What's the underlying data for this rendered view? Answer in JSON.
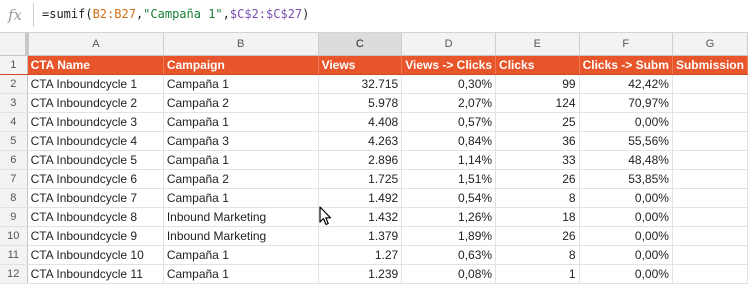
{
  "formula_bar": {
    "fx_label": "fx",
    "parts": [
      "=sumif(",
      "B2:B27",
      ",",
      "\"Campaña 1\"",
      ",",
      "$C$2:$C$27",
      ")"
    ]
  },
  "columns": [
    "A",
    "B",
    "C",
    "D",
    "E",
    "F",
    "G"
  ],
  "header": {
    "row_number": "1",
    "cells": [
      "CTA Name",
      "Campaign",
      "Views",
      "Views -> Clicks",
      "Clicks",
      "Clicks -> Subm",
      "Submission"
    ]
  },
  "rows": [
    {
      "n": "2",
      "cells": [
        "CTA Inboundcycle 1",
        "Campaña 1",
        "32.715",
        "0,30%",
        "99",
        "42,42%",
        ""
      ]
    },
    {
      "n": "3",
      "cells": [
        "CTA Inboundcycle 2",
        "Campaña 2",
        "5.978",
        "2,07%",
        "124",
        "70,97%",
        ""
      ]
    },
    {
      "n": "4",
      "cells": [
        "CTA Inboundcycle 3",
        "Campaña 1",
        "4.408",
        "0,57%",
        "25",
        "0,00%",
        ""
      ]
    },
    {
      "n": "5",
      "cells": [
        "CTA Inboundcycle 4",
        "Campaña 3",
        "4.263",
        "0,84%",
        "36",
        "55,56%",
        ""
      ]
    },
    {
      "n": "6",
      "cells": [
        "CTA Inboundcycle 5",
        "Campaña 1",
        "2.896",
        "1,14%",
        "33",
        "48,48%",
        ""
      ]
    },
    {
      "n": "7",
      "cells": [
        "CTA Inboundcycle 6",
        "Campaña 2",
        "1.725",
        "1,51%",
        "26",
        "53,85%",
        ""
      ]
    },
    {
      "n": "8",
      "cells": [
        "CTA Inboundcycle 7",
        "Campaña 1",
        "1.492",
        "0,54%",
        "8",
        "0,00%",
        ""
      ]
    },
    {
      "n": "9",
      "cells": [
        "CTA Inboundcycle 8",
        "Inbound Marketing",
        "1.432",
        "1,26%",
        "18",
        "0,00%",
        ""
      ]
    },
    {
      "n": "10",
      "cells": [
        "CTA Inboundcycle 9",
        "Inbound Marketing",
        "1.379",
        "1,89%",
        "26",
        "0,00%",
        ""
      ]
    },
    {
      "n": "11",
      "cells": [
        "CTA Inboundcycle 10",
        "Campaña 1",
        "1.27",
        "0,63%",
        "8",
        "0,00%",
        ""
      ]
    },
    {
      "n": "12",
      "cells": [
        "CTA Inboundcycle 11",
        "Campaña 1",
        "1.239",
        "0,08%",
        "1",
        "0,00%",
        ""
      ]
    }
  ],
  "active_column": "C",
  "accent_color": "#e8552a"
}
